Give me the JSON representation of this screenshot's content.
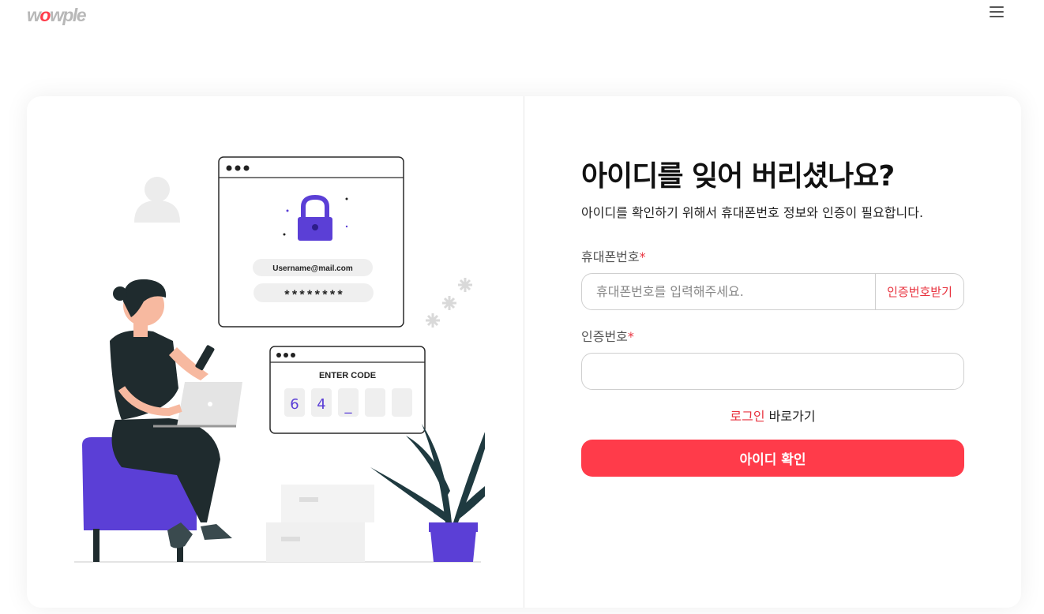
{
  "header": {
    "logo_text": "wowple",
    "menu_icon": "hamburger-menu-icon"
  },
  "illustration": {
    "email": "Username@mail.com",
    "password": "********",
    "code_title": "ENTER CODE",
    "code_digits": [
      "6",
      "4",
      "_",
      "",
      ""
    ]
  },
  "form": {
    "title": "아이디를 잊어 버리셨나요?",
    "subtitle": "아이디를 확인하기 위해서 휴대폰번호 정보와 인증이 필요합니다.",
    "phone_label": "휴대폰번호",
    "required_mark": "*",
    "phone_placeholder": "휴대폰번호를 입력해주세요.",
    "phone_value": "",
    "get_code_label": "인증번호받기",
    "code_label": "인증번호",
    "code_value": "",
    "login_link": "로그인",
    "login_suffix": " 바로가기",
    "submit_label": "아이디 확인"
  },
  "colors": {
    "accent": "#ff3b4a",
    "purple": "#5b3fd6",
    "dark": "#1f2b2e"
  }
}
